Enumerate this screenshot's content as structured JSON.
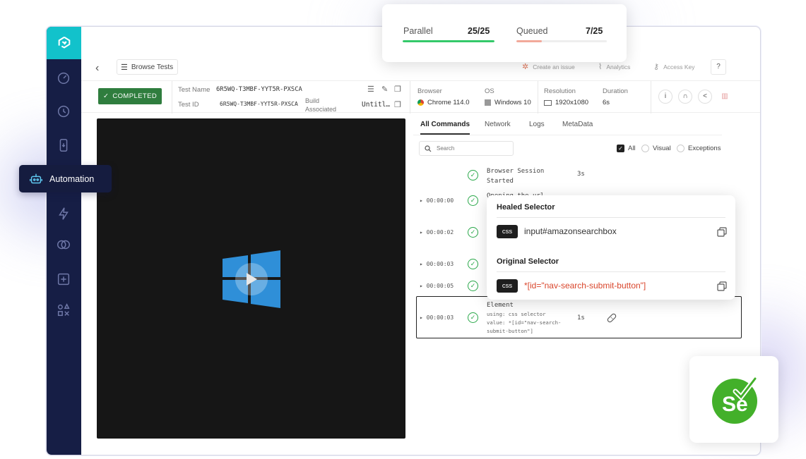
{
  "colors": {
    "sidebar": "#161e45",
    "accent": "#12c2cb",
    "success": "#2f7d3e",
    "check": "#2aa84a",
    "parallel_bar": "#34c96a",
    "queued_bar": "#f2a99a",
    "error_text": "#d9452b"
  },
  "parallel_card": {
    "parallel_label": "Parallel",
    "parallel_value": "25/25",
    "parallel_fraction": 1.0,
    "queued_label": "Queued",
    "queued_value": "7/25",
    "queued_fraction": 0.28
  },
  "automation_label": "Automation",
  "topbar": {
    "browse_label": "Browse Tests",
    "create_issue": "Create an issue",
    "analytics": "Analytics",
    "access_key": "Access Key",
    "help": "?"
  },
  "info": {
    "status": "COMPLETED",
    "test_name_label": "Test Name",
    "test_name": "6R5WQ-T3MBF-YYT5R-PXSCA",
    "test_id_label": "Test ID",
    "test_id": "6R5WQ-T3MBF-YYT5R-PXSCA",
    "build_label": "Build Associated",
    "build_value": "Untitl…",
    "browser_label": "Browser",
    "browser_value": "Chrome 114.0",
    "os_label": "OS",
    "os_value": "Windows 10",
    "resolution_label": "Resolution",
    "resolution_value": "1920x1080",
    "duration_label": "Duration",
    "duration_value": "6s"
  },
  "tabs": [
    "All Commands",
    "Network",
    "Logs",
    "MetaData"
  ],
  "search_placeholder": "Search",
  "filters": {
    "all": "All",
    "visual": "Visual",
    "exceptions": "Exceptions"
  },
  "commands": [
    {
      "time": "",
      "text": "Browser Session Started",
      "dur": "3s"
    },
    {
      "time": "▸ 00:00:00",
      "text": "Opening the url"
    },
    {
      "time": "▸ 00:00:02",
      "text": ""
    },
    {
      "time": "▸ 00:00:03",
      "text": ""
    },
    {
      "time": "▸ 00:00:05",
      "text": ""
    },
    {
      "time": "▸ 00:00:03",
      "text": "Element",
      "sub1": "using: css selector",
      "sub2": "value: *[id=\"nav-search-",
      "sub3": "submit-button\"]",
      "dur": "1s"
    }
  ],
  "popup": {
    "healed_title": "Healed Selector",
    "healed_tag": "css",
    "healed_value": "input#amazonsearchbox",
    "original_title": "Original Selector",
    "original_tag": "css",
    "original_value": "*[id=\"nav-search-submit-button\"]"
  },
  "selenium_logo_text": "Se"
}
